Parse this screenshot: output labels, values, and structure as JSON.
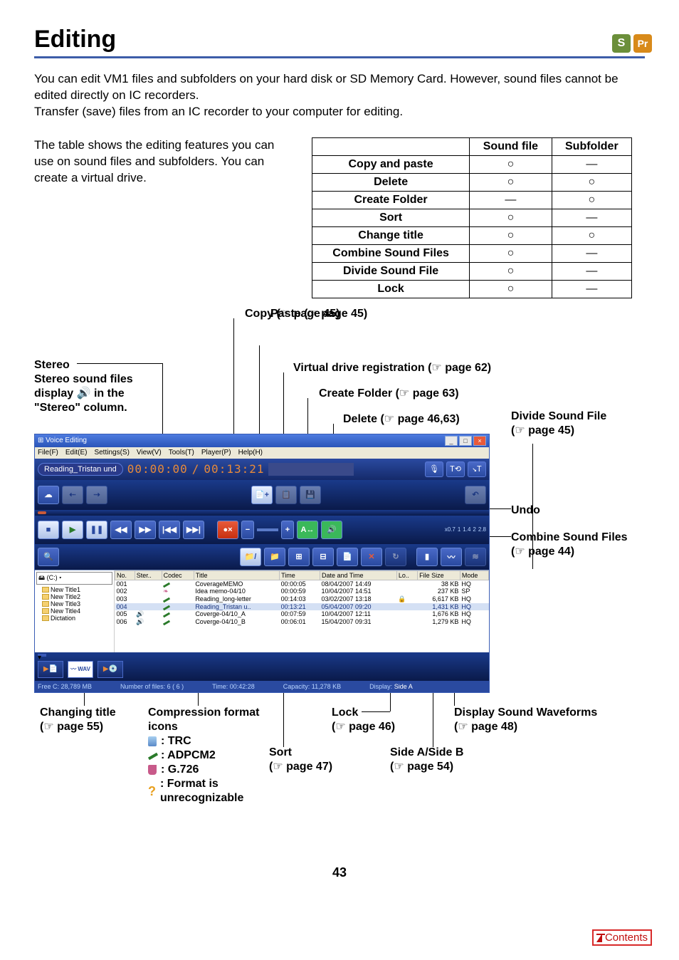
{
  "header": {
    "title": "Editing",
    "badge_s": "S",
    "badge_pr": "Pr"
  },
  "intro": {
    "p1": "You can edit VM1 files and subfolders on your hard disk or SD Memory Card. However, sound files cannot be edited directly on IC recorders.",
    "p2": "Transfer (save) files from an IC recorder to your computer for editing."
  },
  "left_note": "The table shows the editing features you can use on sound files and subfolders. You can create a virtual drive.",
  "table": {
    "h_sound": "Sound file",
    "h_sub": "Subfolder",
    "rows": [
      {
        "name": "Copy and paste",
        "sound": "○",
        "sub": "—"
      },
      {
        "name": "Delete",
        "sound": "○",
        "sub": "○"
      },
      {
        "name": "Create Folder",
        "sound": "—",
        "sub": "○"
      },
      {
        "name": "Sort",
        "sound": "○",
        "sub": "—"
      },
      {
        "name": "Change title",
        "sound": "○",
        "sub": "○"
      },
      {
        "name": "Combine Sound Files",
        "sound": "○",
        "sub": "—"
      },
      {
        "name": "Divide Sound File",
        "sound": "○",
        "sub": "—"
      },
      {
        "name": "Lock",
        "sound": "○",
        "sub": "—"
      }
    ]
  },
  "callouts": {
    "copy": "Copy (",
    "copy_page": "page 45)",
    "paste": "Paste (",
    "paste_page": "page 45)",
    "stereo_title": "Stereo",
    "stereo_l1": "Stereo sound files",
    "stereo_l2a": "display ",
    "stereo_l2b": " in the",
    "stereo_l3": "\"Stereo\" column.",
    "vdrive": "Virtual drive registration (",
    "vdrive_page": "page 62)",
    "createf": "Create Folder (",
    "createf_page": "page 63)",
    "delete": "Delete (",
    "delete_page": "page 46,63)",
    "divide": "Divide Sound File",
    "divide_p": "(",
    "divide_page": "page 45)",
    "undo": "Undo",
    "combine": "Combine Sound Files",
    "combine_p": "(",
    "combine_page": "page 44)",
    "changing": "Changing title",
    "changing_p": "(",
    "changing_page": "page 55)",
    "compression": "Compression format icons",
    "trc": ": TRC",
    "adpcm": ": ADPCM2",
    "g726": ": G.726",
    "fmt_un": ": Format is unrecognizable",
    "lock": "Lock",
    "lock_p": "(",
    "lock_page": "page 46)",
    "dispwave": "Display Sound Waveforms",
    "dispwave_p": "(",
    "dispwave_page": "page 48)",
    "sort": "Sort",
    "sort_p": "(",
    "sort_page": "page 47)",
    "side": "Side A/Side B",
    "side_p": "(",
    "side_page": "page 54)"
  },
  "app": {
    "title": "Voice Editing",
    "menu_file": "File(F)",
    "menu_edit": "Edit(E)",
    "menu_settings": "Settings(S)",
    "menu_view": "View(V)",
    "menu_tools": "Tools(T)",
    "menu_player": "Player(P)",
    "menu_help": "Help(H)",
    "filename": "Reading_Tristan und",
    "time_l": "00:00:00",
    "time_sep": "/",
    "time_r": "00:13:21",
    "drive": "(C:)",
    "tree": [
      "New Title1",
      "New Title2",
      "New Title3",
      "New Title4",
      "Dictation"
    ],
    "cols": [
      "No.",
      "Ster..",
      "Codec",
      "Title",
      "Time",
      "Date and Time",
      "Lo..",
      "File Size",
      "Mode"
    ],
    "rows": [
      {
        "no": "001",
        "ster": "",
        "codec": "p",
        "title": "CoverageMEMO",
        "time": "00:00:05",
        "dt": "08/04/2007 14:49",
        "lo": "",
        "size": "38 KB",
        "mode": "HQ"
      },
      {
        "no": "002",
        "ster": "",
        "codec": "g",
        "title": "Idea memo-04/10",
        "time": "00:00:59",
        "dt": "10/04/2007 14:51",
        "lo": "",
        "size": "237 KB",
        "mode": "SP"
      },
      {
        "no": "003",
        "ster": "",
        "codec": "p",
        "title": "Reading_long-letter",
        "time": "00:14:03",
        "dt": "03/02/2007 13:18",
        "lo": "🔒",
        "size": "6,617 KB",
        "mode": "HQ"
      },
      {
        "no": "004",
        "ster": "",
        "codec": "p",
        "title": "Reading_Tristan u..",
        "time": "00:13:21",
        "dt": "05/04/2007 09:20",
        "lo": "",
        "size": "1,431 KB",
        "mode": "HQ"
      },
      {
        "no": "005",
        "ster": "🔊",
        "codec": "p",
        "title": "Coverge-04/10_A",
        "time": "00:07:59",
        "dt": "10/04/2007 12:11",
        "lo": "",
        "size": "1,676 KB",
        "mode": "HQ"
      },
      {
        "no": "006",
        "ster": "🔊",
        "codec": "p",
        "title": "Coverge-04/10_B",
        "time": "00:06:01",
        "dt": "15/04/2007 09:31",
        "lo": "",
        "size": "1,279 KB",
        "mode": "HQ"
      }
    ],
    "status": {
      "free": "Free C: 28,789 MB",
      "numf": "Number of files: 6 ( 6 )",
      "time": "Time: 00:42:28",
      "cap": "Capacity: 11,278 KB",
      "disp": "Display:",
      "side": "Side A"
    },
    "scale": {
      "a": "x0.7",
      "b": "1",
      "c": "1.4",
      "d": "2",
      "e": "2.8"
    }
  },
  "page_num": "43",
  "contents": "Contents"
}
